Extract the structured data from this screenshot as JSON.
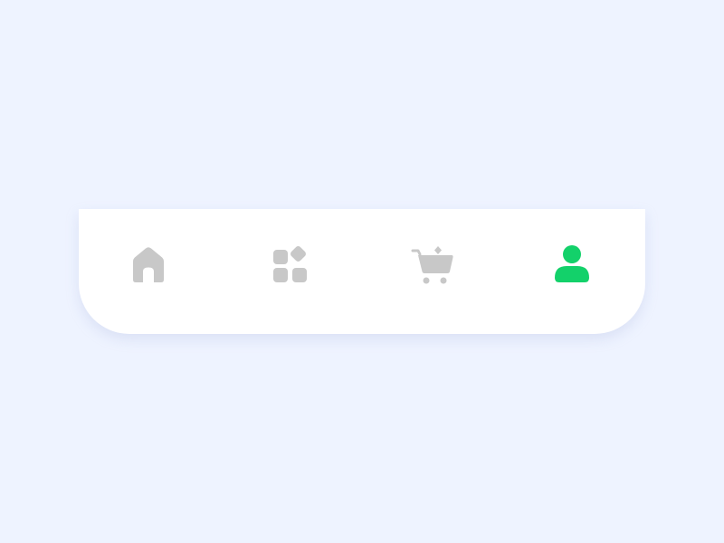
{
  "colors": {
    "background": "#eef3ff",
    "bar": "#ffffff",
    "inactive_icon": "#c8c8c8",
    "active_icon": "#13d16a"
  },
  "tabbar": {
    "active_tab": "profile",
    "tabs": [
      {
        "id": "home",
        "icon": "home-icon",
        "active": false
      },
      {
        "id": "apps",
        "icon": "apps-grid-icon",
        "active": false
      },
      {
        "id": "cart",
        "icon": "shopping-cart-icon",
        "active": false
      },
      {
        "id": "profile",
        "icon": "user-icon",
        "active": true
      }
    ]
  }
}
